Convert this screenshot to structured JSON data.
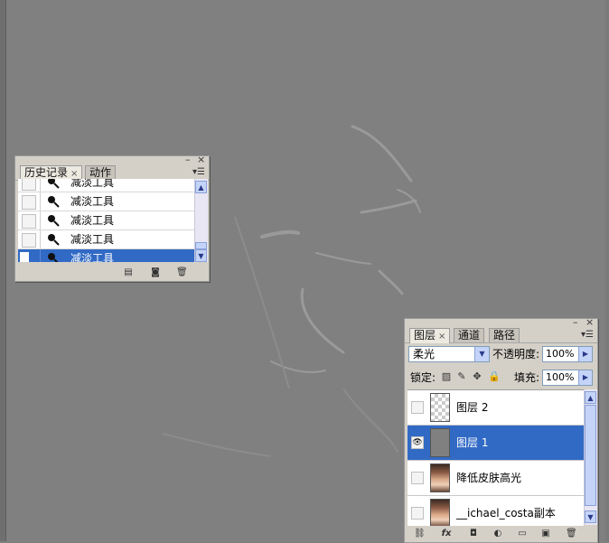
{
  "history_panel": {
    "tabs": [
      {
        "label": "历史记录",
        "active": true
      },
      {
        "label": "动作",
        "active": false
      }
    ],
    "close_glyph": "×",
    "items": [
      {
        "label": "减淡工具",
        "selected": false
      },
      {
        "label": "减淡工具",
        "selected": false
      },
      {
        "label": "减淡工具",
        "selected": false
      },
      {
        "label": "减淡工具",
        "selected": false
      },
      {
        "label": "减淡工具",
        "selected": true
      }
    ],
    "footer_icons": [
      "new-document-icon",
      "snapshot-camera-icon",
      "trash-icon"
    ]
  },
  "layers_panel": {
    "tabs": [
      {
        "label": "图层",
        "active": true
      },
      {
        "label": "通道",
        "active": false
      },
      {
        "label": "路径",
        "active": false
      }
    ],
    "close_glyph": "×",
    "blend_mode": "柔光",
    "opacity_label": "不透明度:",
    "opacity_value": "100%",
    "lock_label": "锁定:",
    "fill_label": "填充:",
    "fill_value": "100%",
    "layers": [
      {
        "name": "图层 2",
        "thumb": "transparent",
        "visible": false,
        "selected": false
      },
      {
        "name": "图层 1",
        "thumb": "gray",
        "visible": true,
        "selected": true
      },
      {
        "name": "降低皮肤高光",
        "thumb": "photo",
        "visible": false,
        "selected": false
      },
      {
        "name": "__ichael_costa副本",
        "thumb": "photo",
        "visible": false,
        "selected": false
      }
    ],
    "footer_labels": {
      "fx": "fx"
    },
    "footer_icons": [
      "link-icon",
      "fx-icon",
      "mask-icon",
      "adjustment-icon",
      "folder-icon",
      "new-layer-icon",
      "trash-icon"
    ]
  },
  "colors": {
    "canvas": "#808080",
    "panel": "#d4d0c8",
    "selection": "#316ac5"
  }
}
